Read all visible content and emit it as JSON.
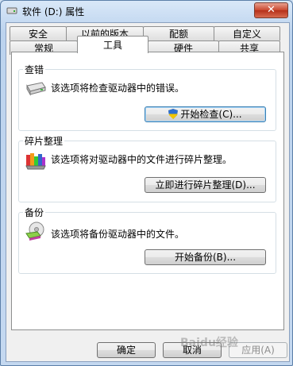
{
  "window": {
    "title": "软件 (D:) 属性",
    "close_label": "✕"
  },
  "tabs_back": [
    "安全",
    "以前的版本",
    "配额",
    "自定义"
  ],
  "tabs_front": [
    "常规",
    "工具",
    "硬件",
    "共享"
  ],
  "active_tab": "工具",
  "groups": {
    "check": {
      "title": "查错",
      "text": "该选项将检查驱动器中的错误。",
      "button": "开始检查(C)..."
    },
    "defrag": {
      "title": "碎片整理",
      "text": "该选项将对驱动器中的文件进行碎片整理。",
      "button": "立即进行碎片整理(D)..."
    },
    "backup": {
      "title": "备份",
      "text": "该选项将备份驱动器中的文件。",
      "button": "开始备份(B)..."
    }
  },
  "footer": {
    "ok": "确定",
    "cancel": "取消",
    "apply": "应用(A)"
  },
  "watermark": "Baidu经验",
  "colors": {
    "accent": "#3c7fb1",
    "close": "#c9462c"
  }
}
